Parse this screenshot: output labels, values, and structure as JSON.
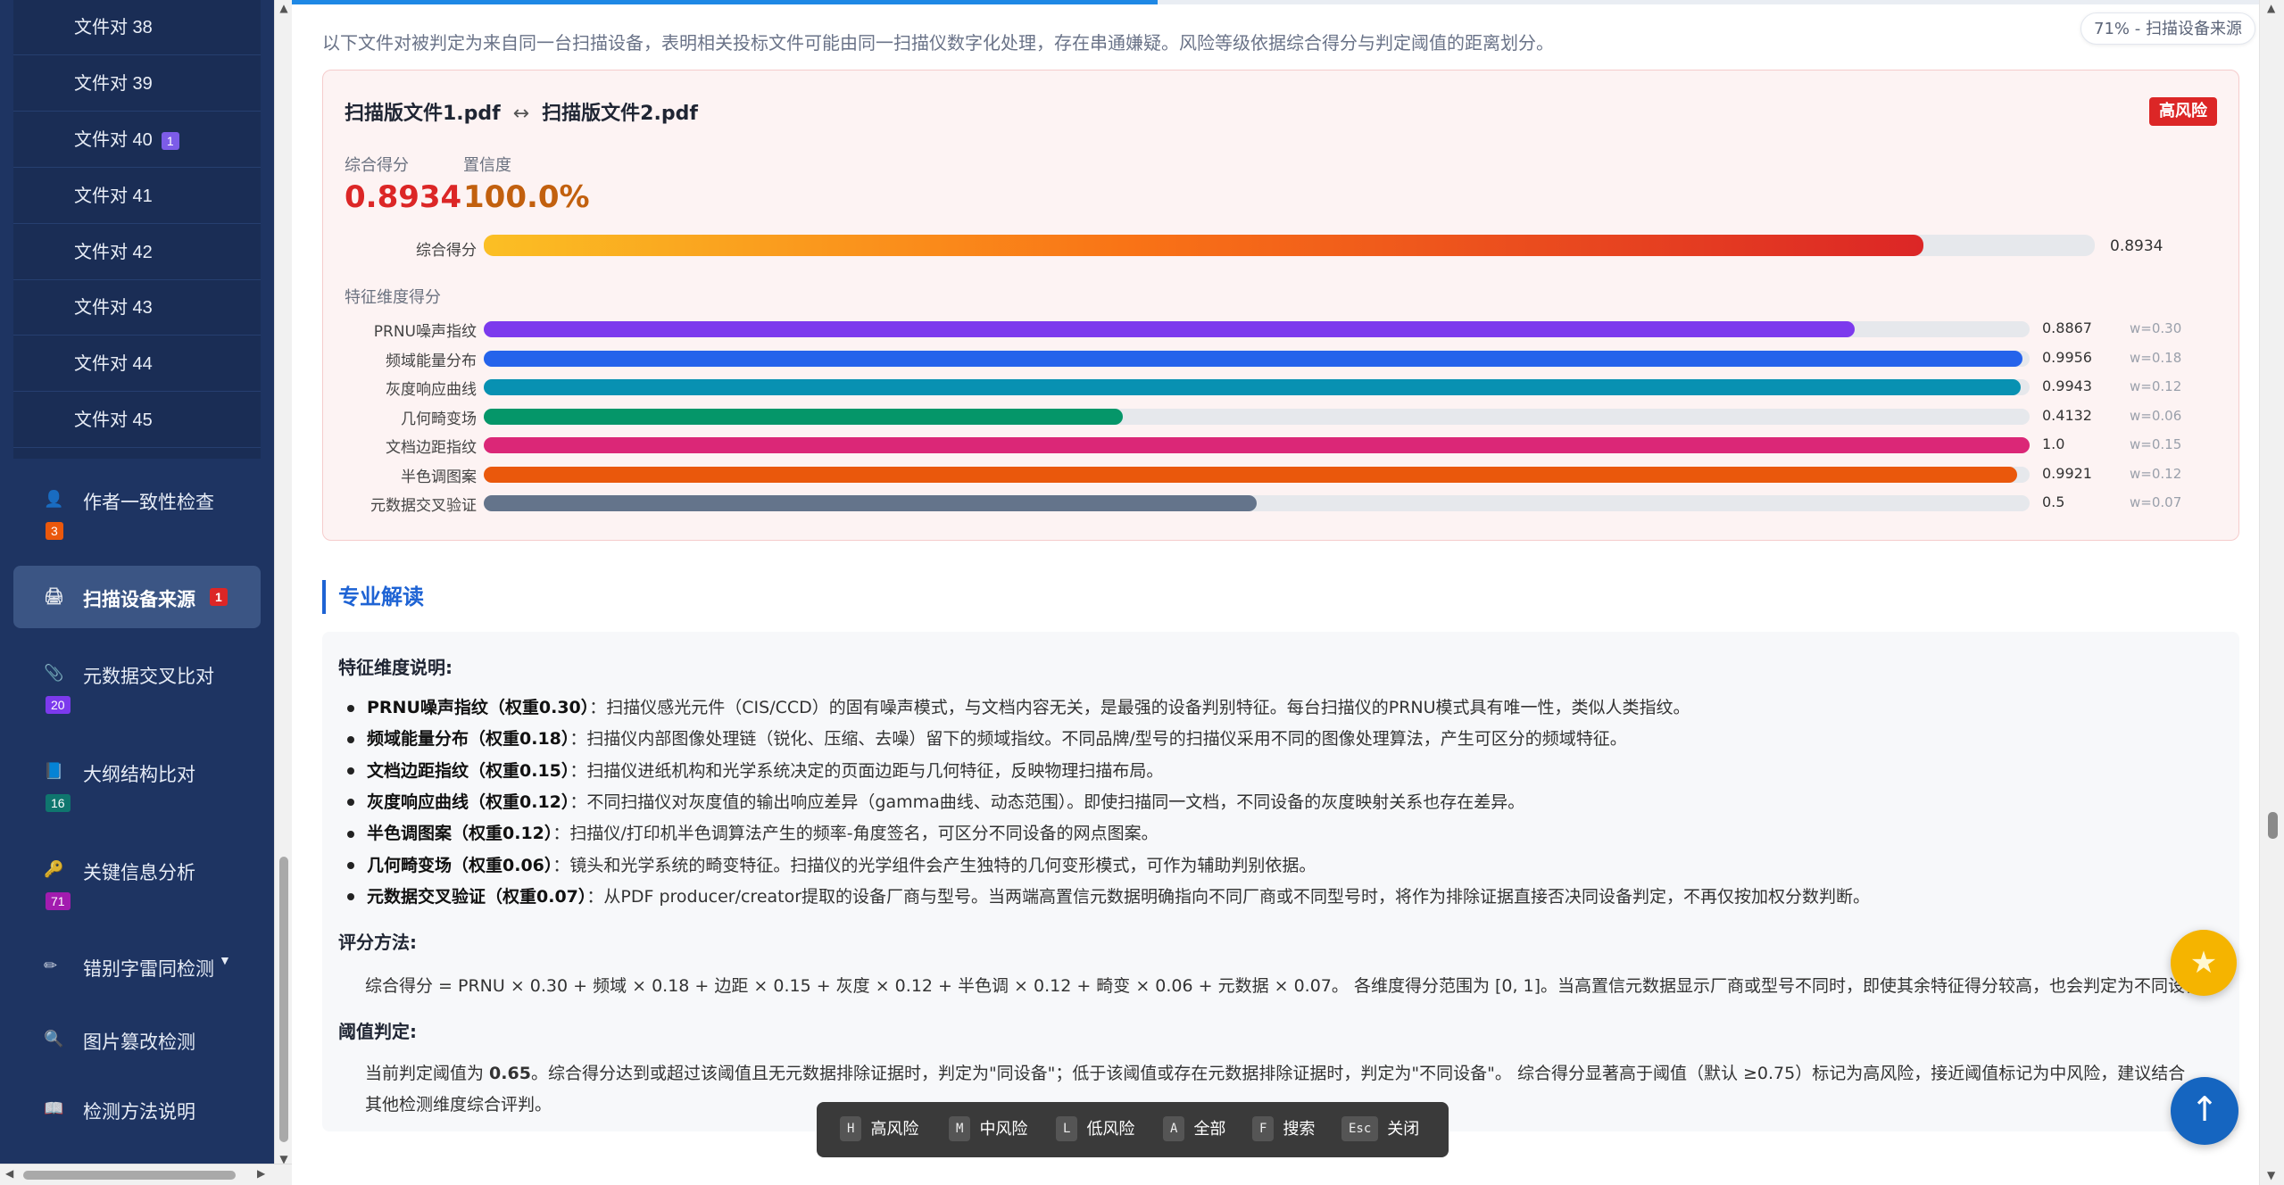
{
  "sidebar": {
    "sub_items": [
      {
        "label": "文件对 38",
        "badge": ""
      },
      {
        "label": "文件对 39",
        "badge": ""
      },
      {
        "label": "文件对 40",
        "badge": "1"
      },
      {
        "label": "文件对 41",
        "badge": ""
      },
      {
        "label": "文件对 42",
        "badge": ""
      },
      {
        "label": "文件对 43",
        "badge": ""
      },
      {
        "label": "文件对 44",
        "badge": ""
      },
      {
        "label": "文件对 45",
        "badge": ""
      }
    ],
    "nav": [
      {
        "label": "作者一致性检查",
        "badge": "3",
        "icon": "user-icon"
      },
      {
        "label": "扫描设备来源",
        "badge": "1",
        "icon": "printer-icon"
      },
      {
        "label": "元数据交叉比对",
        "badge": "20",
        "icon": "paperclip-icon"
      },
      {
        "label": "大纲结构比对",
        "badge": "16",
        "icon": "book-icon"
      },
      {
        "label": "关键信息分析",
        "badge": "71",
        "icon": "key-icon"
      },
      {
        "label": "错别字雷同检测",
        "badge": "",
        "icon": "pencil-icon",
        "caret": "▼"
      },
      {
        "label": "图片篡改检测",
        "badge": "",
        "icon": "magnifier-icon"
      },
      {
        "label": "检测方法说明",
        "badge": "",
        "icon": "book-open-icon"
      }
    ],
    "colors": {
      "bg": "#1e3462",
      "active": "#3b5584"
    }
  },
  "header": {
    "progress_percent": 71,
    "progress_pill": "71% - 扫描设备来源",
    "intro": "以下文件对被判定为来自同一台扫描设备，表明相关投标文件可能由同一扫描仪数字化处理，存在串通嫌疑。风险等级依据综合得分与判定阈值的距离划分。"
  },
  "pair": {
    "file_a": "扫描版文件1.pdf",
    "arrow": "↔",
    "file_b": "扫描版文件2.pdf",
    "risk": "高风险",
    "score_label": "综合得分",
    "score_value": "0.8934",
    "confidence_label": "置信度",
    "confidence_value": "100.0%",
    "overall_bar": {
      "label": "综合得分",
      "value": 0.8934,
      "value_text": "0.8934"
    },
    "dims_title": "特征维度得分",
    "dims": [
      {
        "label": "PRNU噪声指纹",
        "value": 0.8867,
        "value_text": "0.8867",
        "weight": "w=0.30",
        "color": "#7c3aed"
      },
      {
        "label": "频域能量分布",
        "value": 0.9956,
        "value_text": "0.9956",
        "weight": "w=0.18",
        "color": "#2563eb"
      },
      {
        "label": "灰度响应曲线",
        "value": 0.9943,
        "value_text": "0.9943",
        "weight": "w=0.12",
        "color": "#0891b2"
      },
      {
        "label": "几何畸变场",
        "value": 0.4132,
        "value_text": "0.4132",
        "weight": "w=0.06",
        "color": "#059669"
      },
      {
        "label": "文档边距指纹",
        "value": 1.0,
        "value_text": "1.0",
        "weight": "w=0.15",
        "color": "#db2777"
      },
      {
        "label": "半色调图案",
        "value": 0.9921,
        "value_text": "0.9921",
        "weight": "w=0.12",
        "color": "#ea580c"
      },
      {
        "label": "元数据交叉验证",
        "value": 0.5,
        "value_text": "0.5",
        "weight": "w=0.07",
        "color": "#64748b"
      }
    ]
  },
  "interpretation": {
    "heading": "专业解读",
    "features_title": "特征维度说明:",
    "features": [
      {
        "name": "PRNU噪声指纹（权重0.30）",
        "desc": "：扫描仪感光元件（CIS/CCD）的固有噪声模式，与文档内容无关，是最强的设备判别特征。每台扫描仪的PRNU模式具有唯一性，类似人类指纹。"
      },
      {
        "name": "频域能量分布（权重0.18）",
        "desc": "：扫描仪内部图像处理链（锐化、压缩、去噪）留下的频域指纹。不同品牌/型号的扫描仪采用不同的图像处理算法，产生可区分的频域特征。"
      },
      {
        "name": "文档边距指纹（权重0.15）",
        "desc": "：扫描仪进纸机构和光学系统决定的页面边距与几何特征，反映物理扫描布局。"
      },
      {
        "name": "灰度响应曲线（权重0.12）",
        "desc": "：不同扫描仪对灰度值的输出响应差异（gamma曲线、动态范围）。即使扫描同一文档，不同设备的灰度映射关系也存在差异。"
      },
      {
        "name": "半色调图案（权重0.12）",
        "desc": "：扫描仪/打印机半色调算法产生的频率-角度签名，可区分不同设备的网点图案。"
      },
      {
        "name": "几何畸变场（权重0.06）",
        "desc": "：镜头和光学系统的畸变特征。扫描仪的光学组件会产生独特的几何变形模式，可作为辅助判别依据。"
      },
      {
        "name": "元数据交叉验证（权重0.07）",
        "desc": "：从PDF producer/creator提取的设备厂商与型号。当两端高置信元数据明确指向不同厂商或不同型号时，将作为排除证据直接否决同设备判定，不再仅按加权分数判断。"
      }
    ],
    "method_title": "评分方法:",
    "method_text": "综合得分 = PRNU × 0.30 + 频域 × 0.18 + 边距 × 0.15 + 灰度 × 0.12 + 半色调 × 0.12 + 畸变 × 0.06 + 元数据 × 0.07。 各维度得分范围为 [0, 1]。当高置信元数据显示厂商或型号不同时，即使其余特征得分较高，也会判定为不同设备。",
    "threshold_title": "阈值判定:",
    "threshold_pre": "当前判定阈值为 ",
    "threshold_value": "0.65",
    "threshold_line1": "。综合得分达到或超过该阈值且无元数据排除证据时，判定为\"同设备\"；低于该阈值或存在元数据排除证据时，判定为\"不同设备\"。 综合得分显著高于阈值（默认 ≥0.75）标记为高风险，接近阈值标记为中风险，建议结合",
    "threshold_line2": "其他检测维度综合评判。"
  },
  "shortcuts": [
    {
      "key": "H",
      "label": "高风险"
    },
    {
      "key": "M",
      "label": "中风险"
    },
    {
      "key": "L",
      "label": "低风险"
    },
    {
      "key": "A",
      "label": "全部"
    },
    {
      "key": "F",
      "label": "搜索"
    },
    {
      "key": "Esc",
      "label": "关闭"
    }
  ],
  "fab": {
    "star_icon": "star-icon",
    "star_glyph": "★",
    "top_icon": "arrow-up-icon",
    "top_glyph": "↑"
  }
}
